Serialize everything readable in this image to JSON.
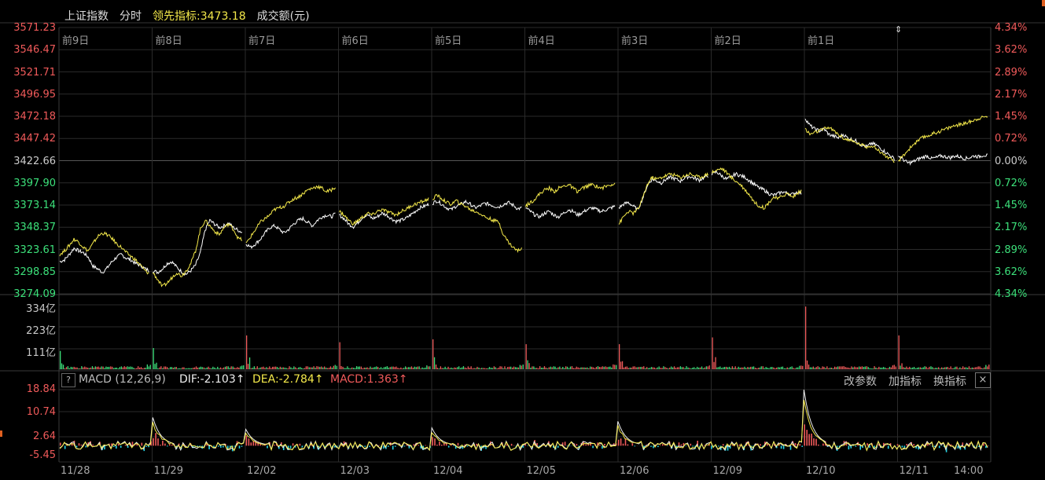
{
  "header": {
    "index_name": "上证指数",
    "mode": "分时",
    "leading_label": "领先指标:",
    "leading_value": "3473.18",
    "volume_label": "成交额(元)"
  },
  "colors": {
    "up": "#f05a5a",
    "down": "#3ce07a",
    "price_line": "#ffffff",
    "leading_line": "#f4e94a",
    "macd_negative": "#29d6e8",
    "grid": "#2a2a2a"
  },
  "price_axis": {
    "left": [
      "3571.23",
      "3546.47",
      "3521.71",
      "3496.95",
      "3472.18",
      "3447.42",
      "3422.66",
      "3397.90",
      "3373.14",
      "3348.37",
      "3323.61",
      "3298.85",
      "3274.09"
    ],
    "right": [
      "4.34%",
      "3.62%",
      "2.89%",
      "2.17%",
      "1.45%",
      "0.72%",
      "0.00%",
      "0.72%",
      "1.45%",
      "2.17%",
      "2.89%",
      "3.62%",
      "4.34%"
    ]
  },
  "day_labels": [
    "前9日",
    "前8日",
    "前7日",
    "前6日",
    "前5日",
    "前4日",
    "前3日",
    "前2日",
    "前1日"
  ],
  "volume_axis": [
    "334亿",
    "223亿",
    "111亿"
  ],
  "macd": {
    "help": "?",
    "name": "MACD (12,26,9)",
    "dif": "DIF:-2.103↑",
    "dea": "DEA:-2.784↑",
    "macd": "MACD:1.363↑",
    "axis": [
      "18.84",
      "10.74",
      "2.64",
      "-5.45"
    ],
    "tools": [
      "改参数",
      "加指标",
      "换指标"
    ],
    "close": "×"
  },
  "x_labels": [
    "11/28",
    "11/29",
    "12/02",
    "12/03",
    "12/04",
    "12/05",
    "12/06",
    "12/09",
    "12/10",
    "12/11",
    "14:00"
  ],
  "chart_data": [
    {
      "type": "line",
      "title": "上证指数 分时",
      "x": [
        "11/28",
        "11/29",
        "12/02",
        "12/03",
        "12/04",
        "12/05",
        "12/06",
        "12/09",
        "12/10",
        "12/11"
      ],
      "ylim": [
        3274.09,
        3571.23
      ],
      "series": [
        {
          "name": "上证指数",
          "values": [
            [
              3310,
              3312,
              3318,
              3325,
              3322,
              3320,
              3315,
              3305,
              3302,
              3298,
              3303,
              3310,
              3315,
              3318,
              3314,
              3312,
              3308,
              3306,
              3302,
              3300
            ],
            [
              3300,
              3298,
              3302,
              3308,
              3310,
              3304,
              3299,
              3296,
              3300,
              3306,
              3320,
              3345,
              3356,
              3352,
              3348,
              3350,
              3353,
              3348,
              3345,
              3342
            ],
            [
              3330,
              3326,
              3330,
              3335,
              3342,
              3348,
              3350,
              3346,
              3342,
              3346,
              3352,
              3356,
              3358,
              3354,
              3350,
              3356,
              3360,
              3362,
              3360,
              3364
            ],
            [
              3362,
              3358,
              3352,
              3349,
              3354,
              3360,
              3362,
              3358,
              3360,
              3364,
              3362,
              3358,
              3355,
              3356,
              3358,
              3362,
              3366,
              3370,
              3372,
              3374
            ],
            [
              3375,
              3378,
              3374,
              3370,
              3368,
              3372,
              3374,
              3377,
              3374,
              3370,
              3372,
              3375,
              3374,
              3372,
              3371,
              3374,
              3376,
              3373,
              3369,
              3370
            ],
            [
              3370,
              3366,
              3362,
              3360,
              3364,
              3366,
              3362,
              3360,
              3364,
              3368,
              3366,
              3362,
              3365,
              3368,
              3370,
              3368,
              3366,
              3368,
              3370,
              3372
            ],
            [
              3370,
              3374,
              3376,
              3372,
              3368,
              3380,
              3395,
              3402,
              3400,
              3398,
              3402,
              3404,
              3402,
              3400,
              3404,
              3405,
              3403,
              3401,
              3404,
              3406
            ],
            [
              3408,
              3410,
              3406,
              3402,
              3404,
              3408,
              3406,
              3404,
              3400,
              3396,
              3392,
              3390,
              3386,
              3384,
              3386,
              3388,
              3386,
              3385,
              3388,
              3386
            ],
            [
              3470,
              3462,
              3458,
              3456,
              3458,
              3452,
              3450,
              3448,
              3452,
              3448,
              3446,
              3444,
              3440,
              3438,
              3442,
              3440,
              3436,
              3432,
              3428,
              3424
            ],
            [
              3428,
              3424,
              3420,
              3421,
              3424,
              3426,
              3428,
              3425,
              3426,
              3428,
              3427,
              3426,
              3428,
              3427,
              3425,
              3426,
              3428,
              3427,
              3429,
              3428
            ]
          ]
        },
        {
          "name": "领先指标",
          "values": [
            [
              3318,
              3322,
              3328,
              3335,
              3332,
              3326,
              3322,
              3330,
              3338,
              3342,
              3340,
              3336,
              3330,
              3326,
              3320,
              3316,
              3312,
              3306,
              3300,
              3296
            ],
            [
              3298,
              3290,
              3282,
              3286,
              3292,
              3298,
              3294,
              3300,
              3308,
              3322,
              3346,
              3356,
              3350,
              3344,
              3340,
              3348,
              3352,
              3346,
              3336,
              3334
            ],
            [
              3330,
              3338,
              3346,
              3354,
              3358,
              3362,
              3368,
              3370,
              3372,
              3376,
              3380,
              3382,
              3386,
              3390,
              3392,
              3394,
              3392,
              3388,
              3390,
              3394
            ],
            [
              3366,
              3362,
              3356,
              3352,
              3356,
              3360,
              3364,
              3362,
              3366,
              3368,
              3366,
              3364,
              3362,
              3366,
              3368,
              3372,
              3374,
              3376,
              3378,
              3380
            ],
            [
              3380,
              3384,
              3380,
              3376,
              3374,
              3378,
              3374,
              3372,
              3368,
              3366,
              3364,
              3360,
              3358,
              3356,
              3354,
              3340,
              3332,
              3326,
              3322,
              3326
            ],
            [
              3372,
              3376,
              3380,
              3386,
              3390,
              3392,
              3388,
              3392,
              3394,
              3396,
              3392,
              3388,
              3392,
              3394,
              3396,
              3394,
              3392,
              3394,
              3396,
              3398
            ],
            [
              3352,
              3360,
              3366,
              3364,
              3368,
              3380,
              3396,
              3404,
              3402,
              3404,
              3406,
              3408,
              3406,
              3404,
              3406,
              3408,
              3406,
              3404,
              3406,
              3408
            ],
            [
              3410,
              3412,
              3414,
              3410,
              3404,
              3400,
              3396,
              3390,
              3384,
              3376,
              3372,
              3370,
              3376,
              3382,
              3380,
              3384,
              3386,
              3382,
              3386,
              3390
            ],
            [
              3458,
              3452,
              3454,
              3456,
              3458,
              3460,
              3456,
              3452,
              3448,
              3446,
              3444,
              3442,
              3440,
              3438,
              3440,
              3436,
              3432,
              3428,
              3424,
              3420
            ],
            [
              3422,
              3428,
              3434,
              3440,
              3444,
              3448,
              3450,
              3452,
              3454,
              3456,
              3458,
              3460,
              3462,
              3463,
              3464,
              3466,
              3468,
              3470,
              3471,
              3473
            ]
          ]
        }
      ]
    },
    {
      "type": "bar",
      "title": "成交额(元)",
      "ylim": [
        0,
        334
      ],
      "categories": [
        "11/28",
        "11/29",
        "12/02",
        "12/03",
        "12/04",
        "12/05",
        "12/06",
        "12/09",
        "12/10",
        "12/11"
      ],
      "opening_values": [
        95,
        110,
        175,
        140,
        155,
        130,
        130,
        165,
        325,
        175
      ]
    },
    {
      "type": "bar",
      "title": "MACD (12,26,9)",
      "ylim": [
        -5.45,
        18.84
      ],
      "peaks": [
        {
          "day": "11/29",
          "dif_peak": 9.5
        },
        {
          "day": "12/02",
          "dif_peak": 5.5
        },
        {
          "day": "12/04",
          "dif_peak": 6.0
        },
        {
          "day": "12/06",
          "dif_peak": 8.2
        },
        {
          "day": "12/10",
          "dif_peak": 18.84
        }
      ]
    }
  ]
}
